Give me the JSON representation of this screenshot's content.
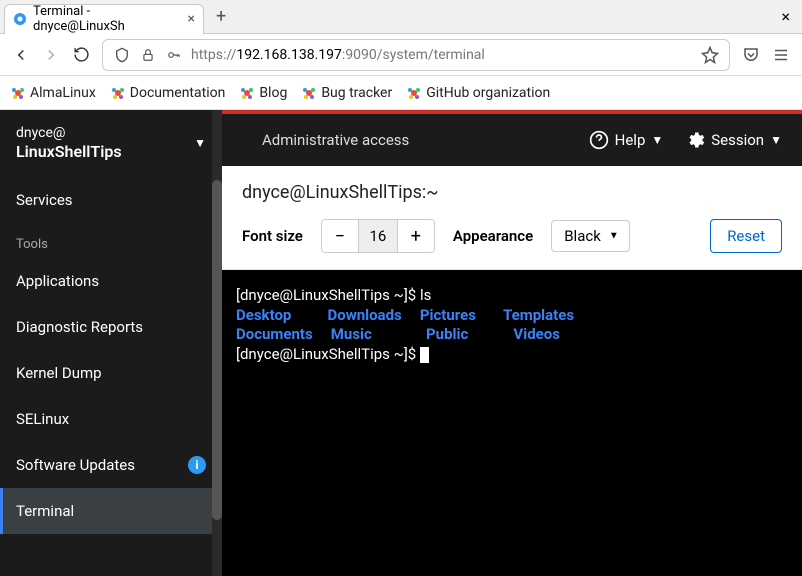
{
  "browser": {
    "tab_title": "Terminal - dnyce@LinuxSh",
    "url_proto": "https://",
    "url_host": "192.168.138.197",
    "url_port_path": ":9090/system/terminal",
    "bookmarks": [
      "AlmaLinux",
      "Documentation",
      "Blog",
      "Bug tracker",
      "GitHub organization"
    ]
  },
  "sidebar": {
    "user": "dnyce@",
    "host": "LinuxShellTips",
    "items": [
      "Services"
    ],
    "tools_label": "Tools",
    "tools": [
      "Applications",
      "Diagnostic Reports",
      "Kernel Dump",
      "SELinux",
      "Software Updates",
      "Terminal"
    ],
    "active": "Terminal",
    "badge_on": "Software Updates"
  },
  "topbar": {
    "admin": "Administrative access",
    "help": "Help",
    "session": "Session"
  },
  "terminal": {
    "title": "dnyce@LinuxShellTips:~",
    "font_size_label": "Font size",
    "font_size_value": "16",
    "appearance_label": "Appearance",
    "appearance_value": "Black",
    "reset_label": "Reset",
    "prompt1": "[dnyce@LinuxShellTips ~]$ ",
    "cmd1": "ls",
    "listing_row1": [
      "Desktop",
      "Downloads",
      "Pictures",
      "Templates"
    ],
    "listing_row2": [
      "Documents",
      "Music",
      "Public",
      "Videos"
    ],
    "prompt2": "[dnyce@LinuxShellTips ~]$ "
  }
}
